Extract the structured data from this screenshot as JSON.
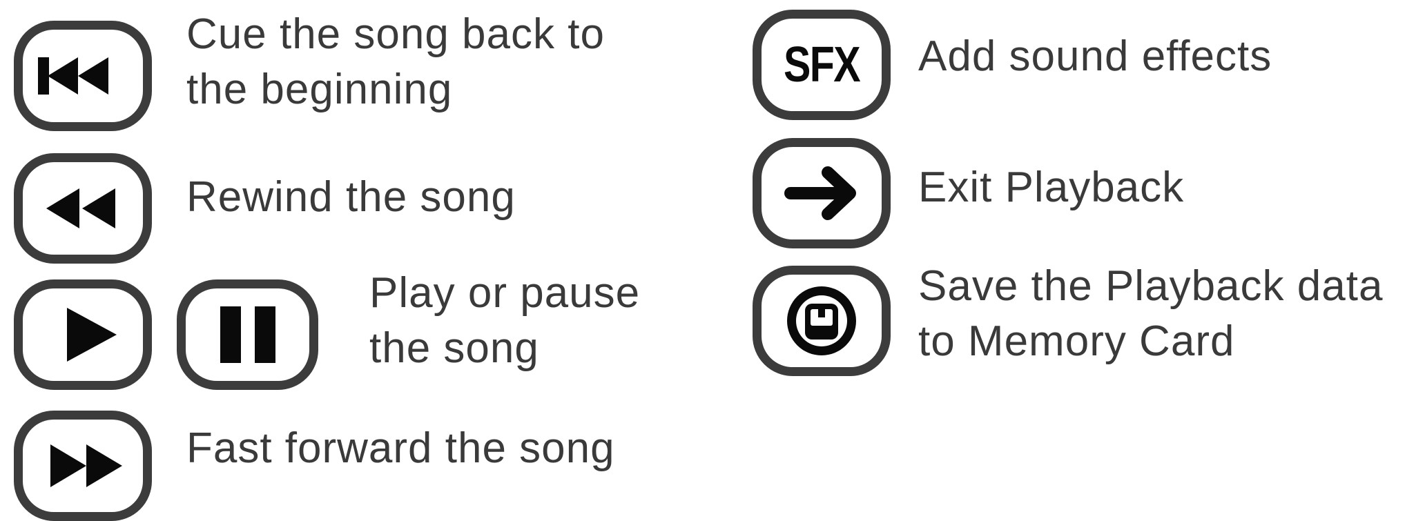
{
  "colors": {
    "text": "#3a3a3a",
    "button_border": "#3c3c3c",
    "icon": "#0a0a0a",
    "background": "#ffffff"
  },
  "controls": [
    {
      "icon": "skip-to-start-icon",
      "lines": [
        "Cue the song back to",
        "the beginning"
      ]
    },
    {
      "icon": "rewind-icon",
      "lines": [
        "Rewind the song"
      ]
    },
    {
      "icon": "play-icon + pause-icon",
      "lines": [
        "Play or pause",
        "the song"
      ]
    },
    {
      "icon": "fast-forward-icon",
      "lines": [
        "Fast forward the song"
      ]
    },
    {
      "icon": "sfx-icon",
      "button_text": "SFX",
      "lines": [
        "Add sound effects"
      ]
    },
    {
      "icon": "arrow-right-icon",
      "lines": [
        "Exit Playback"
      ]
    },
    {
      "icon": "memory-card-icon",
      "lines": [
        "Save the Playback data",
        "to Memory Card"
      ]
    }
  ]
}
